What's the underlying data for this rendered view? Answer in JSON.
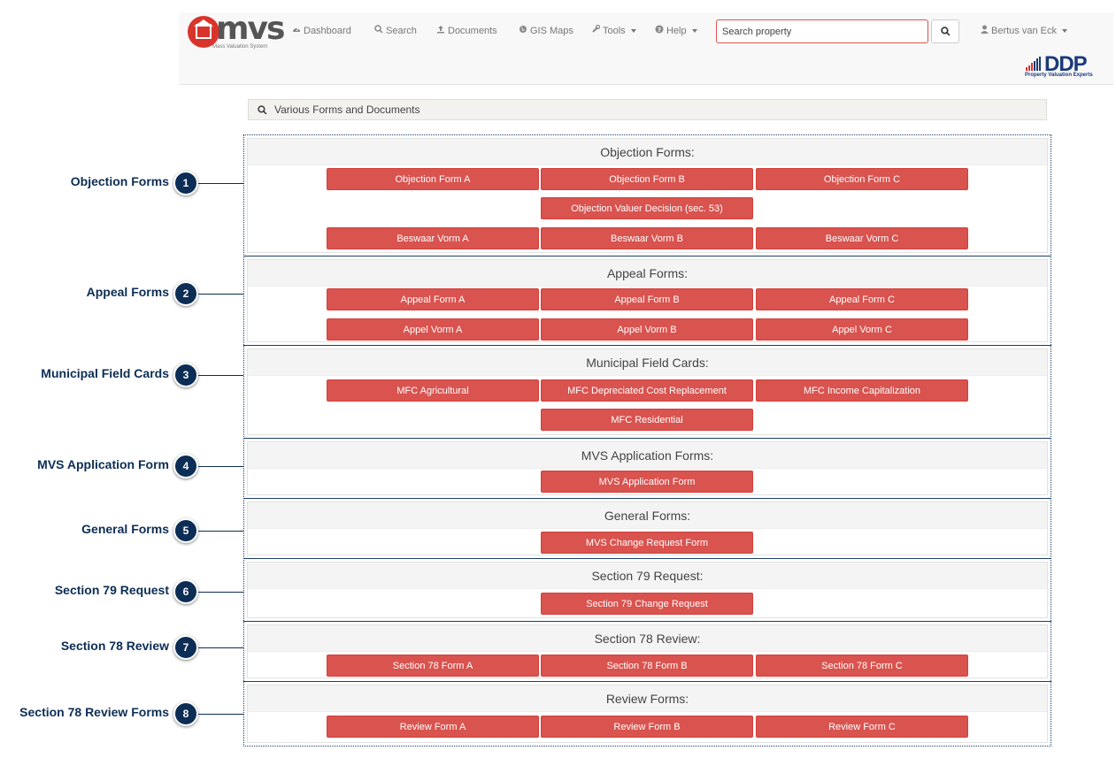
{
  "navbar": {
    "logo_text": "mvs",
    "logo_sub": "Mass Valuation System",
    "items": [
      {
        "label": "Dashboard",
        "icon": "dashboard-icon"
      },
      {
        "label": "Search",
        "icon": "search-icon"
      },
      {
        "label": "Documents",
        "icon": "upload-icon"
      },
      {
        "label": "GIS Maps",
        "icon": "globe-icon"
      },
      {
        "label": "Tools",
        "icon": "wrench-icon"
      },
      {
        "label": "Help",
        "icon": "question-icon"
      }
    ],
    "search_placeholder": "Search property",
    "user": "Bertus van Eck",
    "ddp_text": "DDP",
    "ddp_sub": "Property Valuation Experts"
  },
  "page_header": "Various Forms and Documents",
  "sections": [
    {
      "title": "Objection Forms:",
      "callout": "Objection Forms",
      "num": "1",
      "buttons": [
        "Objection Form A",
        "Objection Form B",
        "Objection Form C",
        "Objection Valuer Decision (sec. 53)",
        "Beswaar Vorm A",
        "Beswaar Vorm B",
        "Beswaar Vorm C"
      ]
    },
    {
      "title": "Appeal Forms:",
      "callout": "Appeal Forms",
      "num": "2",
      "buttons": [
        "Appeal Form A",
        "Appeal Form B",
        "Appeal Form C",
        "Appel Vorm A",
        "Appel Vorm B",
        "Appel Vorm C"
      ]
    },
    {
      "title": "Municipal Field Cards:",
      "callout": "Municipal Field Cards",
      "num": "3",
      "buttons": [
        "MFC Agricultural",
        "MFC Depreciated Cost Replacement",
        "MFC Income Capitalization",
        "MFC Residential"
      ]
    },
    {
      "title": "MVS Application Forms:",
      "callout": "MVS Application Form",
      "num": "4",
      "buttons": [
        "MVS Application Form"
      ]
    },
    {
      "title": "General Forms:",
      "callout": "General Forms",
      "num": "5",
      "buttons": [
        "MVS Change Request Form"
      ]
    },
    {
      "title": "Section 79 Request:",
      "callout": "Section 79 Request",
      "num": "6",
      "buttons": [
        "Section 79 Change Request"
      ]
    },
    {
      "title": "Section 78 Review:",
      "callout": "Section 78 Review",
      "num": "7",
      "buttons": [
        "Section 78 Form A",
        "Section 78 Form B",
        "Section 78 Form C"
      ]
    },
    {
      "title": "Review Forms:",
      "callout": "Section 78 Review Forms",
      "num": "8",
      "buttons": [
        "Review Form A",
        "Review Form B",
        "Review Form C"
      ]
    }
  ],
  "colors": {
    "button": "#d9534f",
    "callout": "#0c2d55",
    "frame": "#1c3f6e"
  }
}
